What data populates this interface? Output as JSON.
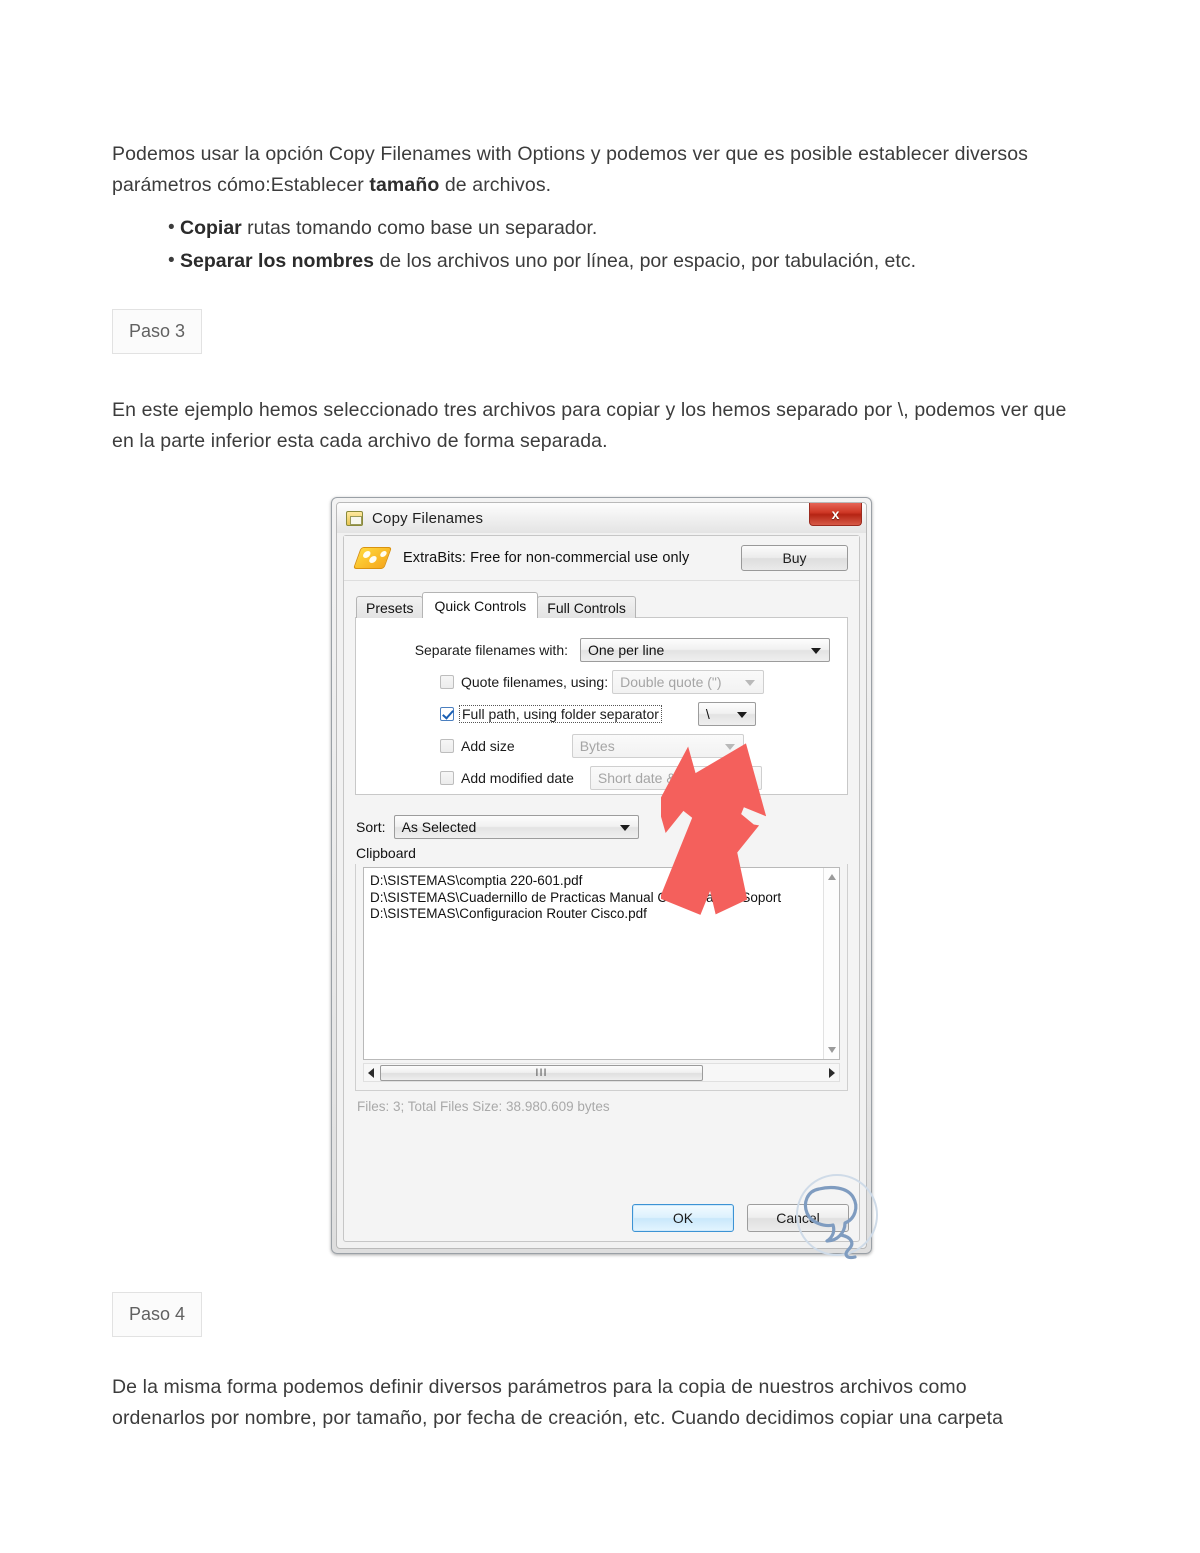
{
  "document": {
    "intro_paragraph_plain": "Podemos usar la opción Copy Filenames with Options y podemos ver que es posible establecer diversos parámetros cómo:Establecer tamaño de archivos.",
    "intro_part1": "Podemos usar la opción Copy Filenames with Options y podemos ver que es posible establecer diversos parámetros cómo:Establecer ",
    "intro_bold": "tamaño",
    "intro_part2": " de archivos.",
    "bullets": [
      {
        "bold": "Copiar",
        "rest": " rutas tomando como base un separador."
      },
      {
        "bold": "Separar los nombres",
        "rest": " de los archivos uno por línea, por espacio, por tabulación, etc."
      }
    ],
    "paso3_label": "Paso 3",
    "paso3_paragraph": "En este ejemplo hemos seleccionado tres archivos para copiar y los hemos separado por \\, podemos ver que en la parte inferior esta cada archivo de forma separada.",
    "paso4_label": "Paso 4",
    "paso4_paragraph": "De la misma forma podemos definir diversos parámetros para la copia de nuestros archivos como ordenarlos por nombre, por tamaño, por fecha de creación, etc. Cuando decidimos copiar una carpeta"
  },
  "dialog": {
    "title": "Copy Filenames",
    "close_label": "x",
    "banner": {
      "text": "ExtraBits: Free for non-commercial use only",
      "buy_label": "Buy"
    },
    "tabs": [
      {
        "label": "Presets",
        "active": false
      },
      {
        "label": "Quick Controls",
        "active": true
      },
      {
        "label": "Full Controls",
        "active": false
      }
    ],
    "options": {
      "separate_label": "Separate filenames with:",
      "separate_value": "One per line",
      "quote_label": "Quote filenames, using:",
      "quote_checked": false,
      "quote_value": "Double quote (\")",
      "fullpath_label": "Full path, using folder separator",
      "fullpath_checked": true,
      "fullpath_value": "\\",
      "addsize_label": "Add size",
      "addsize_checked": false,
      "addsize_value": "Bytes",
      "adddate_label": "Add modified date",
      "adddate_checked": false,
      "adddate_value": "Short date & time"
    },
    "sort": {
      "label": "Sort:",
      "value": "As Selected"
    },
    "clipboard": {
      "group_label": "Clipboard",
      "lines": [
        "D:\\SISTEMAS\\comptia 220-601.pdf",
        "D:\\SISTEMAS\\Cuadernillo de Practicas Manual Curso Basico Soport",
        "D:\\SISTEMAS\\Configuracion Router Cisco.pdf"
      ],
      "scroll_grip": "III"
    },
    "status": "Files: 3;  Total Files Size: 38.980.609 bytes",
    "buttons": {
      "ok": "OK",
      "cancel": "Cancel"
    }
  },
  "annotations": {
    "arrow_color": "#f4605c",
    "watermark_color": "#8fa6c4"
  }
}
